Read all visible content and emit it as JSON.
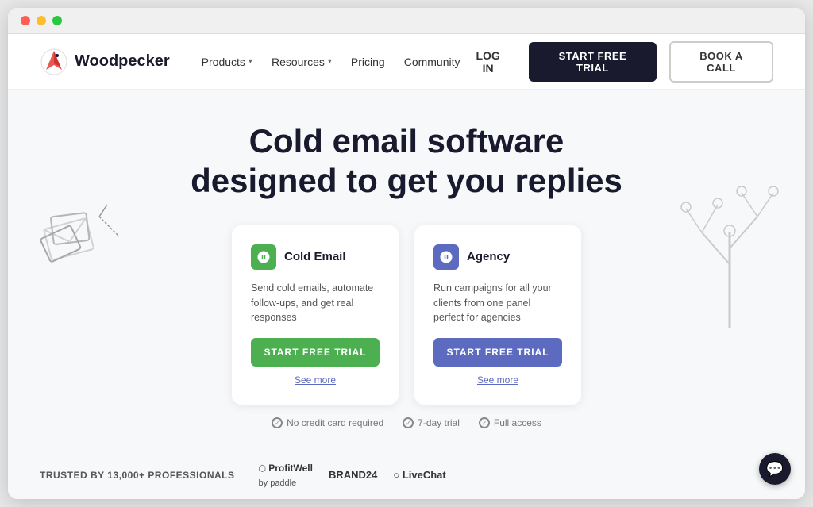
{
  "browser": {
    "dots": [
      "red",
      "yellow",
      "green"
    ]
  },
  "nav": {
    "logo_text": "Woodpecker",
    "links": [
      {
        "label": "Products",
        "has_dropdown": true
      },
      {
        "label": "Resources",
        "has_dropdown": true
      },
      {
        "label": "Pricing",
        "has_dropdown": false
      },
      {
        "label": "Community",
        "has_dropdown": false
      }
    ],
    "login_label": "LOG IN",
    "trial_button": "START FREE TRIAL",
    "call_button": "BOOK A CALL"
  },
  "hero": {
    "title_line1": "Cold email software",
    "title_line2": "designed to get you replies"
  },
  "cards": [
    {
      "id": "cold-email",
      "title": "Cold Email",
      "description": "Send cold emails, automate follow-ups, and get real responses",
      "cta": "START FREE TRIAL",
      "see_more": "See more",
      "icon_type": "green"
    },
    {
      "id": "agency",
      "title": "Agency",
      "description": "Run campaigns for all your clients from one panel perfect for agencies",
      "cta": "START FREE TRIAL",
      "see_more": "See more",
      "icon_type": "blue"
    }
  ],
  "trust": {
    "trusted_label": "TRUSTED BY 13,000+ PROFESSIONALS",
    "badges": [
      {
        "text": "No credit card required"
      },
      {
        "text": "7-day trial"
      },
      {
        "text": "Full access"
      }
    ],
    "brands": [
      {
        "name": "ProfitWell",
        "sub": "by paddle"
      },
      {
        "name": "BRAND24"
      },
      {
        "name": "○  LiveChat"
      }
    ]
  },
  "chat": {
    "icon": "💬"
  }
}
